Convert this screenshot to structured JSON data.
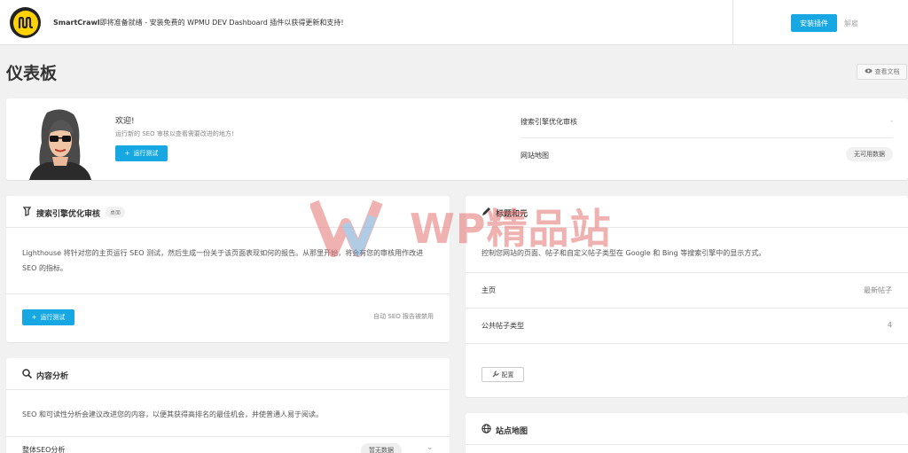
{
  "notice": {
    "brand": "SmartCrawl",
    "message": "即将准备就绪 - 安装免费的 WPMU DEV Dashboard 插件以获得更新和支持!",
    "install_label": "安装插件",
    "dismiss_label": "解雇"
  },
  "page": {
    "title": "仪表板",
    "docs_label": "查看文档"
  },
  "summary": {
    "welcome_title": "欢迎!",
    "welcome_sub": "运行新的 SEO 审核以查看需要改进的地方!",
    "run_label": "运行测试",
    "stats": [
      {
        "label": "搜索引擎优化审核",
        "value": "-"
      },
      {
        "label": "网站地图",
        "value": "无可用数据"
      }
    ]
  },
  "seo_audit": {
    "title": "搜索引擎优化审核",
    "badge": "桌面",
    "description": "Lighthouse 将针对您的主页运行 SEO 测试，然后生成一份关于该页面表现如何的报告。从那里开始，将会有您的审核用作改进 SEO 的指标。",
    "run_label": "运行测试",
    "note": "自动 SEO 报告被禁用"
  },
  "content_analysis": {
    "title": "内容分析",
    "description": "SEO 和可读性分析会建议改进您的内容，以便其获得高排名的最佳机会，并使普通人易于阅读。",
    "row_label": "整体SEO分析",
    "row_pill": "暂无数据"
  },
  "titles_meta": {
    "title": "标题和元",
    "description": "控制您网站的页面、帖子和自定义帖子类型在 Google 和 Bing 等搜索引擎中的显示方式。",
    "rows": [
      {
        "label": "主页",
        "value": "最新帖子"
      },
      {
        "label": "公共帖子类型",
        "value": "4"
      }
    ],
    "configure_label": "配置"
  },
  "sitemap": {
    "title": "站点地图"
  },
  "watermark": {
    "text": "WP精品站"
  },
  "colors": {
    "accent": "#17a8e3",
    "logo_yellow": "#ffd200",
    "watermark_red": "#e57373",
    "watermark_blue": "#64a8dc"
  }
}
